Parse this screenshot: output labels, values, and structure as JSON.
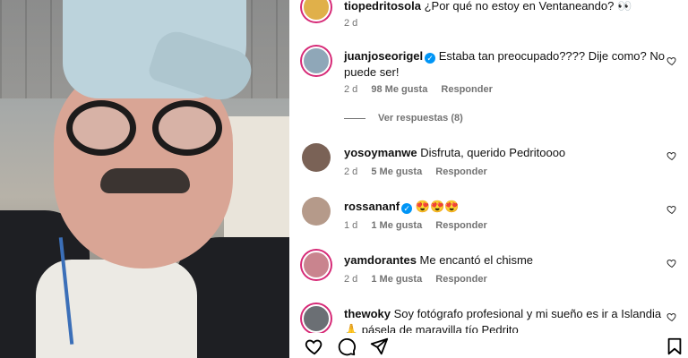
{
  "comments": [
    {
      "user": "tiopedritosola",
      "verified": false,
      "text": "¿Por qué no estoy en Ventaneando? 👀",
      "time": "2 d",
      "likes": "",
      "reply": ""
    },
    {
      "user": "juanjoseorigel",
      "verified": true,
      "text": "Estaba tan preocupado???? Dije como? No puede ser!",
      "time": "2 d",
      "likes": "98 Me gusta",
      "reply": "Responder"
    },
    {
      "user": "yosoymanwe",
      "verified": false,
      "text": "Disfruta, querido Pedritoooo",
      "time": "2 d",
      "likes": "5 Me gusta",
      "reply": "Responder"
    },
    {
      "user": "rossananf",
      "verified": true,
      "text": "😍😍😍",
      "time": "1 d",
      "likes": "1 Me gusta",
      "reply": "Responder"
    },
    {
      "user": "yamdorantes",
      "verified": false,
      "text": "Me encantó el chisme",
      "time": "2 d",
      "likes": "1 Me gusta",
      "reply": "Responder"
    },
    {
      "user": "thewoky",
      "verified": false,
      "text": "Soy fotógrafo profesional y mi sueño es ir a Islandia 🙏 pásela de maravilla tío Pedrito",
      "time": "",
      "likes": "",
      "reply": ""
    }
  ],
  "view_replies": "Ver respuestas (8)",
  "icons": {
    "like": "heart-icon",
    "comment": "comment-icon",
    "share": "send-icon",
    "save": "bookmark-icon"
  },
  "colors": {
    "verified": "#0095f6",
    "story_ring": "#d62976",
    "meta": "#737373"
  }
}
